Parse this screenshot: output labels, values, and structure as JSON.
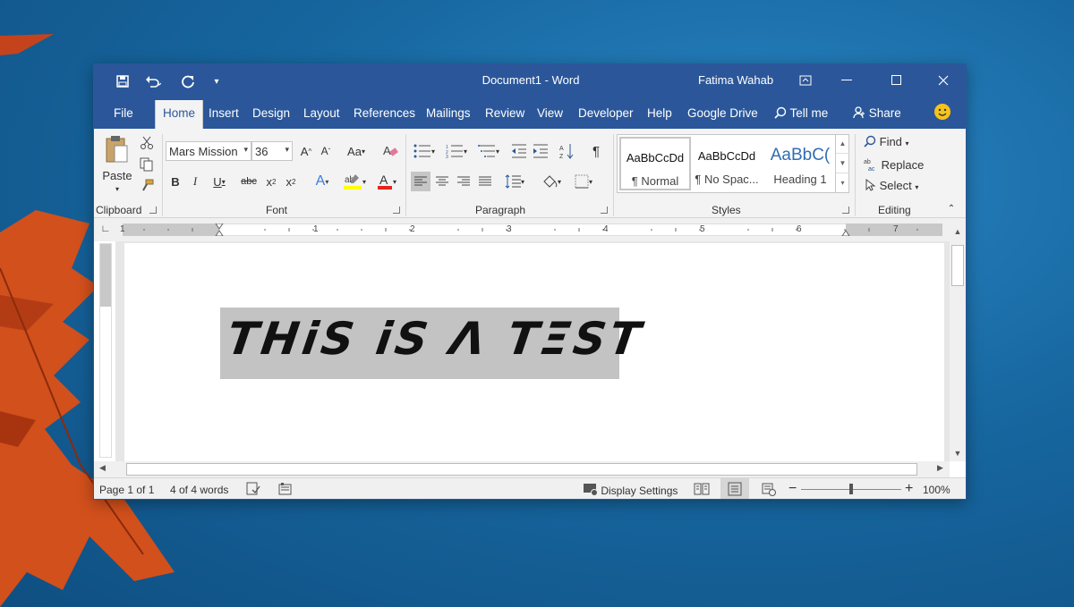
{
  "window": {
    "title": "Document1  -  Word",
    "user": "Fatima Wahab",
    "accent": "#2b579a"
  },
  "quick_access": {
    "save_icon": "save-icon",
    "undo_icon": "undo-icon",
    "redo_icon": "redo-icon",
    "customize_icon": "customize-icon"
  },
  "tabs": [
    "File",
    "Home",
    "Insert",
    "Design",
    "Layout",
    "References",
    "Mailings",
    "Review",
    "View",
    "Developer",
    "Help",
    "Google Drive"
  ],
  "tell_me": "Tell me",
  "share": "Share",
  "ribbon": {
    "clipboard": {
      "paste": "Paste",
      "label": "Clipboard"
    },
    "font": {
      "name": "Mars Mission",
      "size": "36",
      "label": "Font"
    },
    "paragraph": {
      "label": "Paragraph"
    },
    "styles": {
      "label": "Styles",
      "items": [
        {
          "preview": "AaBbCcDd",
          "name": "¶ Normal"
        },
        {
          "preview": "AaBbCcDd",
          "name": "¶ No Spac..."
        },
        {
          "preview": "AaBbC(",
          "name": "Heading 1"
        }
      ]
    },
    "editing": {
      "find": "Find",
      "replace": "Replace",
      "select": "Select",
      "label": "Editing"
    }
  },
  "ruler": {
    "numbers": [
      "1",
      "1",
      "2",
      "3",
      "4",
      "5",
      "6",
      "7"
    ]
  },
  "document": {
    "text": "THiS iS Λ TΞST"
  },
  "status": {
    "page": "Page 1 of 1",
    "words": "4 of 4 words",
    "display_settings": "Display Settings",
    "zoom": "100%",
    "zoom_level": 1.0
  }
}
